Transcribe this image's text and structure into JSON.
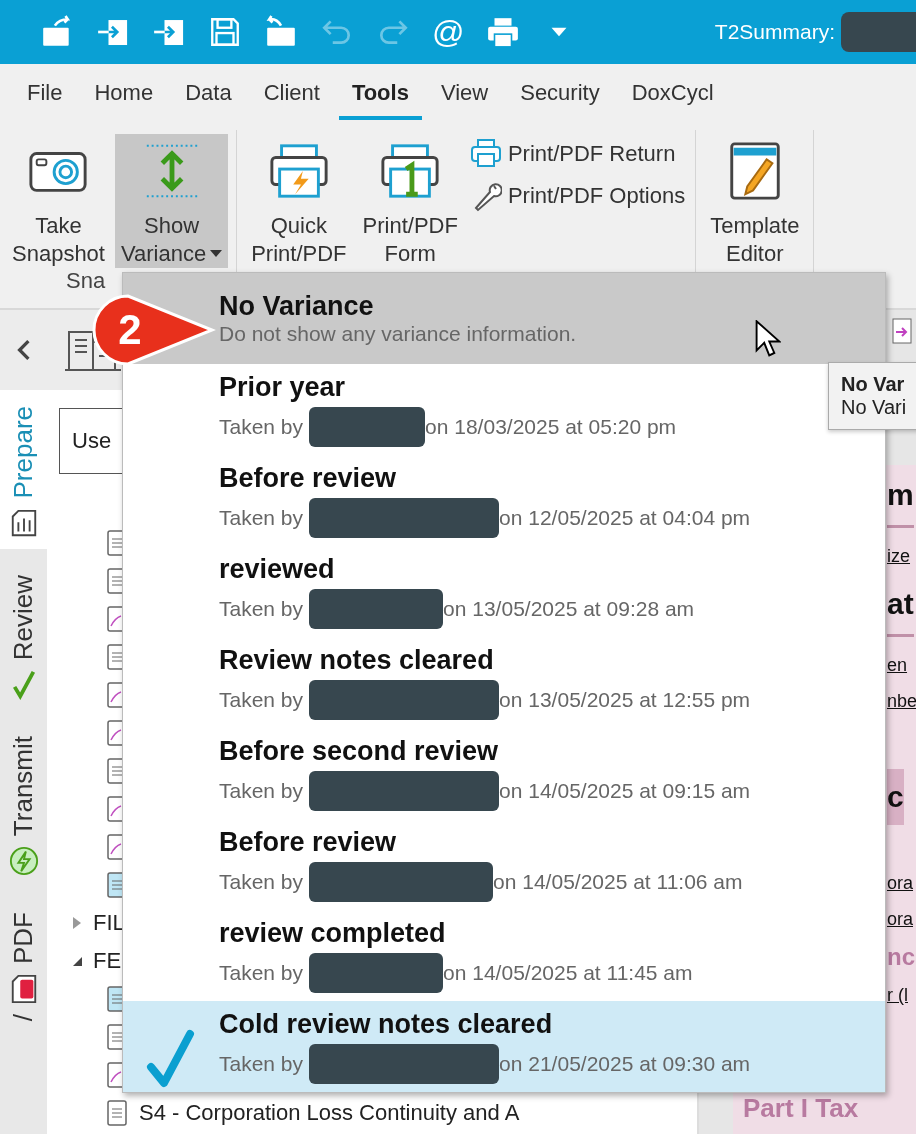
{
  "quick_access": [
    {
      "kind": "export",
      "disabled": false
    },
    {
      "kind": "import",
      "disabled": false
    },
    {
      "kind": "import-d",
      "disabled": false
    },
    {
      "kind": "save",
      "disabled": false
    },
    {
      "kind": "open",
      "disabled": false
    },
    {
      "kind": "undo",
      "disabled": true
    },
    {
      "kind": "redo",
      "disabled": true
    },
    {
      "kind": "email",
      "glyph": "@",
      "disabled": false
    },
    {
      "kind": "print",
      "disabled": false
    },
    {
      "kind": "customize",
      "disabled": false
    }
  ],
  "document_title": "T2Summary:",
  "tabs": [
    {
      "label": "File",
      "selected": false
    },
    {
      "label": "Home",
      "selected": false
    },
    {
      "label": "Data",
      "selected": false
    },
    {
      "label": "Client",
      "selected": false
    },
    {
      "label": "Tools",
      "selected": true
    },
    {
      "label": "View",
      "selected": false
    },
    {
      "label": "Security",
      "selected": false
    },
    {
      "label": "DoxCycl",
      "selected": false
    }
  ],
  "ribbon_groups": [
    {
      "label": "Sna",
      "items": [
        {
          "kind": "large",
          "lines": [
            "Take",
            "Snapshot"
          ],
          "pressed": false,
          "dropdown": false
        },
        {
          "kind": "large",
          "lines": [
            "Show",
            "Variance"
          ],
          "pressed": true,
          "dropdown": true
        }
      ]
    },
    {
      "items": [
        {
          "kind": "large",
          "lines": [
            "Quick",
            "Print/PDF"
          ],
          "pressed": false,
          "dropdown": false
        },
        {
          "kind": "large",
          "lines": [
            "Print/PDF",
            "Form"
          ],
          "pressed": false,
          "dropdown": false
        },
        {
          "kind": "small",
          "lines": [
            "Print/PDF Return"
          ],
          "pressed": false,
          "dropdown": false
        },
        {
          "kind": "small",
          "lines": [
            "Print/PDF Options"
          ],
          "pressed": false,
          "dropdown": false
        }
      ]
    },
    {
      "items": [
        {
          "kind": "large",
          "lines": [
            "Template",
            "Editor"
          ],
          "pressed": false,
          "dropdown": false
        }
      ]
    }
  ],
  "side_tabs": [
    {
      "label": "Prepare",
      "selected": true
    },
    {
      "label": "Review",
      "selected": false
    },
    {
      "label": "Transmit",
      "selected": false
    },
    {
      "label": "PDF",
      "prefix": "/",
      "selected": false
    }
  ],
  "filter_field": {
    "value": "Use"
  },
  "tree": [
    {
      "kind": "doc"
    },
    {
      "kind": "doc"
    },
    {
      "kind": "doc-pen"
    },
    {
      "kind": "doc"
    },
    {
      "kind": "doc-pen"
    },
    {
      "kind": "doc-pen"
    },
    {
      "kind": "doc"
    },
    {
      "kind": "doc-pen"
    },
    {
      "kind": "doc-pen"
    },
    {
      "kind": "doc-active"
    },
    {
      "kind": "group",
      "label": "FIL",
      "expanded": false
    },
    {
      "kind": "group",
      "label": "FE",
      "expanded": true,
      "children": [
        {
          "kind": "doc-active"
        },
        {
          "kind": "doc"
        },
        {
          "kind": "doc-pen"
        },
        {
          "kind": "doc",
          "label": "S4 - Corporation Loss Continuity and A"
        }
      ]
    }
  ],
  "document_lines": [
    {
      "kind": "heading",
      "text": "m"
    },
    {
      "kind": "link",
      "text": "ize"
    },
    {
      "kind": "heading",
      "text": "at"
    },
    {
      "kind": "link",
      "text": "en"
    },
    {
      "kind": "link",
      "text": "nbe"
    },
    {
      "kind": "section",
      "text": "c"
    },
    {
      "kind": "link",
      "text": "ora"
    },
    {
      "kind": "link",
      "text": "ora"
    },
    {
      "kind": "pink",
      "text": "nc"
    },
    {
      "kind": "link",
      "text": "r (l"
    },
    {
      "kind": "part",
      "text": "Part I Tax"
    }
  ],
  "tooltip": {
    "title": "No Var",
    "body": "No Vari"
  },
  "variance_menu": [
    {
      "kind": "none",
      "title": "No Variance",
      "subtitle": "Do not show any variance information.",
      "hovered": true,
      "selected": false
    },
    {
      "kind": "snapshot",
      "title": "Prior year",
      "taken_by": "Taken by",
      "when": "on 18/03/2025 at 05:20 pm",
      "hovered": false,
      "selected": false
    },
    {
      "kind": "snapshot",
      "title": "Before review",
      "taken_by": "Taken by",
      "when": "on 12/05/2025 at 04:04 pm",
      "hovered": false,
      "selected": false
    },
    {
      "kind": "snapshot",
      "title": "reviewed",
      "taken_by": "Taken by",
      "when": "on 13/05/2025 at 09:28 am",
      "hovered": false,
      "selected": false
    },
    {
      "kind": "snapshot",
      "title": "Review notes cleared",
      "taken_by": "Taken by",
      "when": "on 13/05/2025 at 12:55 pm",
      "hovered": false,
      "selected": false
    },
    {
      "kind": "snapshot",
      "title": "Before second review",
      "taken_by": "Taken by",
      "when": "on 14/05/2025 at 09:15 am",
      "hovered": false,
      "selected": false
    },
    {
      "kind": "snapshot",
      "title": "Before review",
      "taken_by": "Taken by",
      "when": "on 14/05/2025 at 11:06 am",
      "hovered": false,
      "selected": false
    },
    {
      "kind": "snapshot",
      "title": "review completed",
      "taken_by": "Taken by",
      "when": "on 14/05/2025 at 11:45 am",
      "hovered": false,
      "selected": false
    },
    {
      "kind": "snapshot",
      "title": "Cold review notes cleared",
      "taken_by": "Taken by",
      "when": "on 21/05/2025 at 09:30 am",
      "hovered": false,
      "selected": true
    }
  ],
  "callout": {
    "number": "2"
  }
}
